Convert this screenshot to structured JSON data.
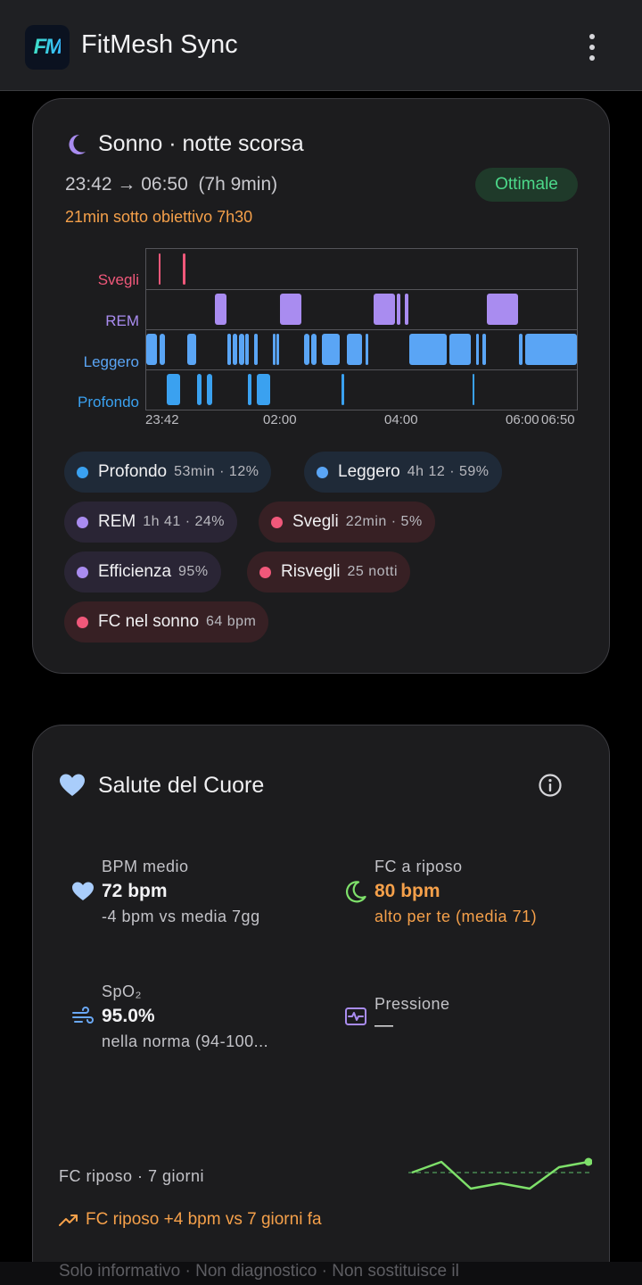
{
  "app": {
    "title": "FitMesh Sync",
    "logo_text": "FM"
  },
  "sleep": {
    "title": "Sonno · notte scorsa",
    "time_range": "23:42 → 06:50  (7h 9min)",
    "status_badge": "Ottimale",
    "warning": "21min sotto obiettivo 7h30",
    "stage_labels": {
      "awake": "Svegli",
      "rem": "REM",
      "light": "Leggero",
      "deep": "Profondo"
    },
    "axis_ticks": [
      "23:42",
      "02:00",
      "04:00",
      "06:00",
      "06:50"
    ],
    "chips": [
      {
        "label": "Profondo",
        "value": "53min · 12%",
        "color": "#3aa1f0"
      },
      {
        "label": "Leggero",
        "value": "4h 12 · 59%",
        "color": "#5aa5f5"
      },
      {
        "label": "REM",
        "value": "1h 41 · 24%",
        "color": "#a98cf0"
      },
      {
        "label": "Svegli",
        "value": "22min · 5%",
        "color": "#f0587a"
      },
      {
        "label": "Efficienza",
        "value": "95%",
        "color": "#a98cf0"
      },
      {
        "label": "Risvegli",
        "value": "25 notti",
        "color": "#f0587a"
      },
      {
        "label": "FC nel sonno",
        "value": "64 bpm",
        "color": "#f0587a"
      }
    ],
    "colors": {
      "awake": "#f0587a",
      "rem": "#a98cf0",
      "light": "#5aa5f5",
      "deep": "#3aa1f0"
    }
  },
  "heart": {
    "title": "Salute del Cuore",
    "metrics": {
      "bpm": {
        "label": "BPM medio",
        "value": "72 bpm",
        "sub": "-4 bpm vs media 7gg"
      },
      "resting": {
        "label": "FC a riposo",
        "value": "80 bpm",
        "sub": "alto per te (media 71)"
      },
      "spo2": {
        "label": "SpO₂",
        "value": "95.0%",
        "sub": "nella norma (94-100..."
      },
      "pressure": {
        "label": "Pressione",
        "value": "—"
      }
    },
    "trend_label": "FC riposo · 7 giorni",
    "trend_note": "FC riposo +4 bpm vs 7 giorni fa",
    "sparkline": [
      74,
      76,
      71,
      72,
      71,
      75,
      76
    ],
    "sparkline_baseline": 74,
    "footer": "Solo informativo · Non diagnostico · Non sostituisce il"
  }
}
